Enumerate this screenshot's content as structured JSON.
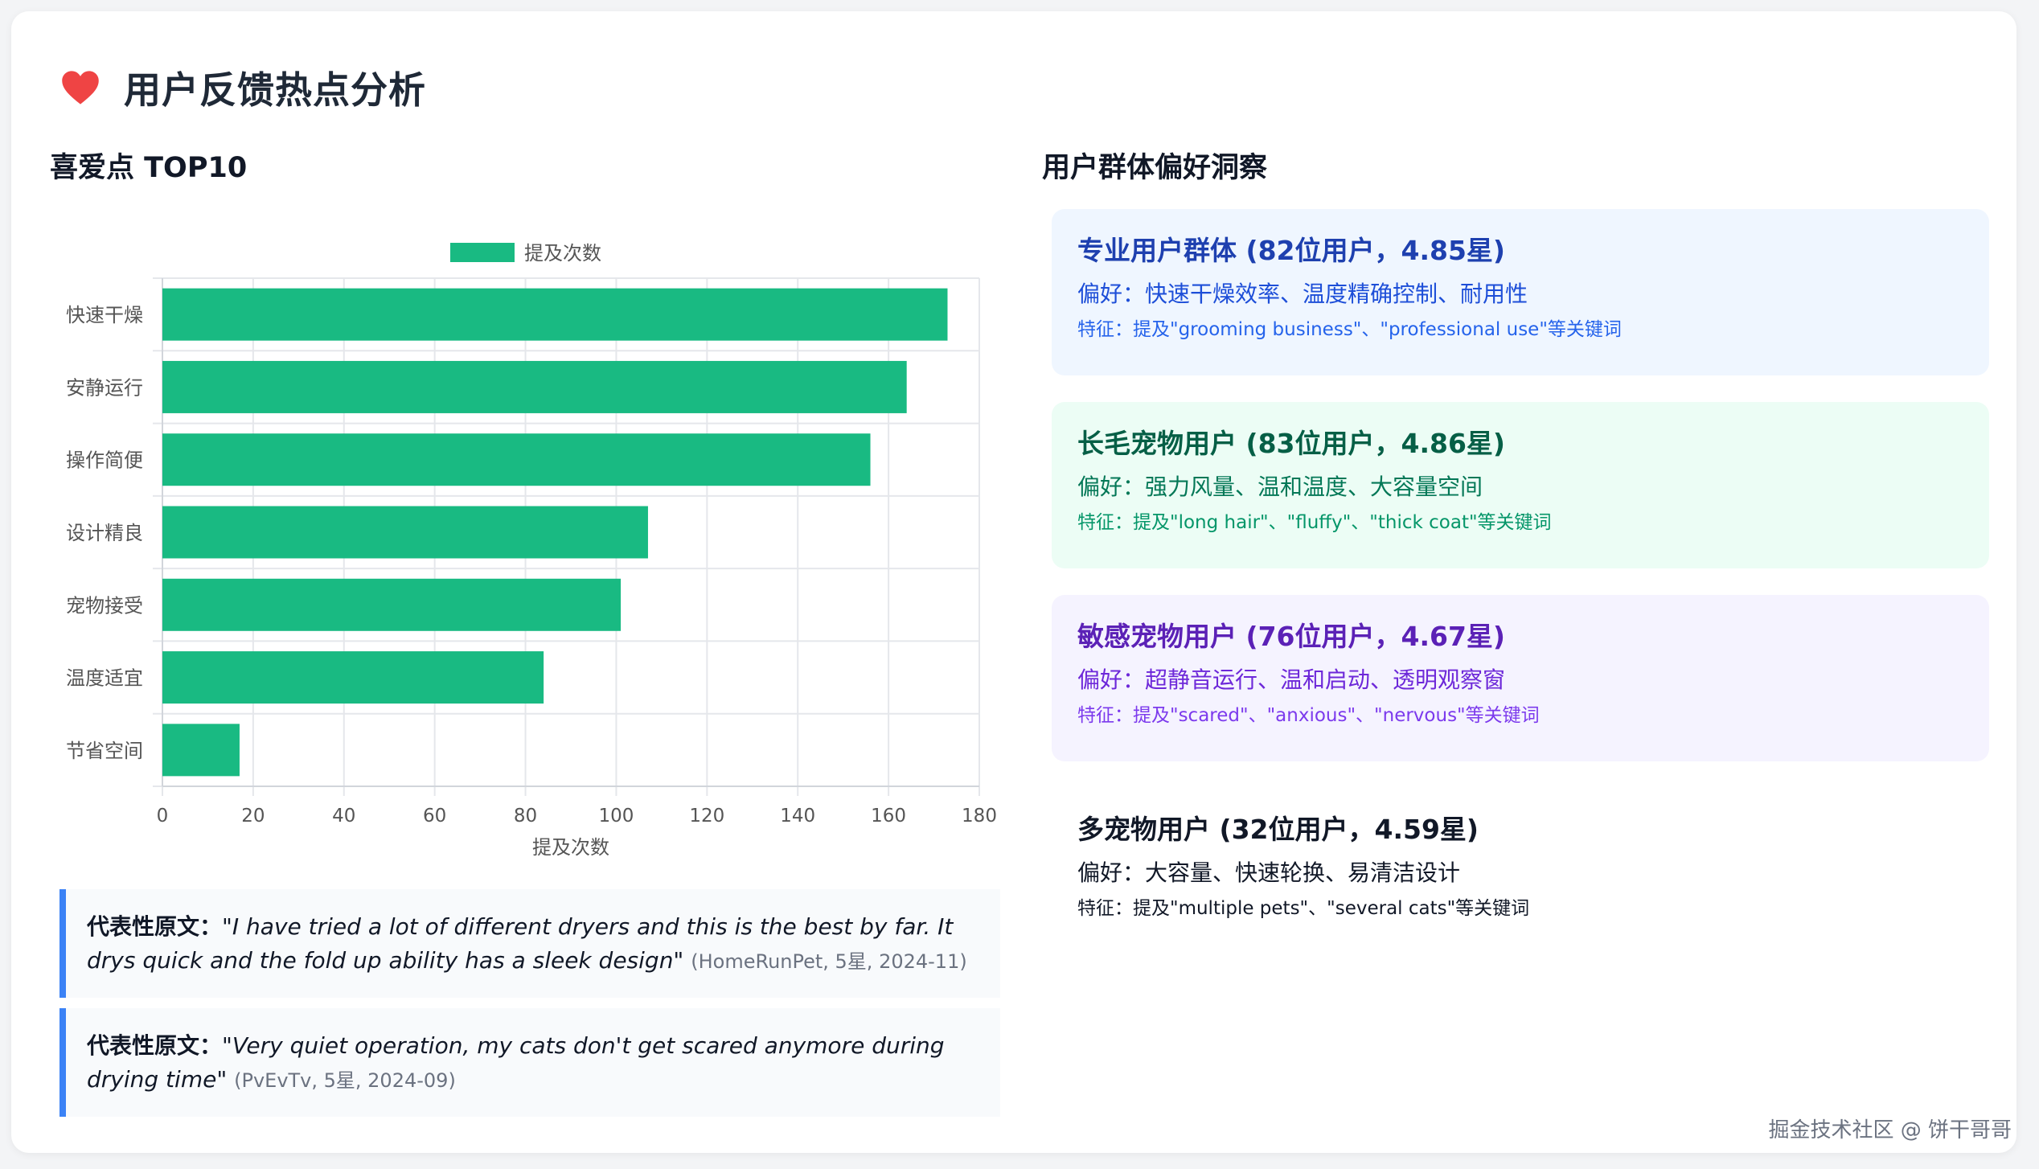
{
  "header": {
    "title": "用户反馈热点分析",
    "icon": "heart-icon",
    "icon_color": "#ef4444"
  },
  "left_section": {
    "title": "喜爱点 TOP10"
  },
  "chart_data": {
    "type": "bar",
    "orientation": "horizontal",
    "categories": [
      "快速干燥",
      "安静运行",
      "操作简便",
      "设计精良",
      "宠物接受",
      "温度适宜",
      "节省空间"
    ],
    "series": [
      {
        "name": "提及次数",
        "values": [
          173,
          164,
          156,
          107,
          101,
          84,
          17
        ],
        "color": "#19ba82"
      }
    ],
    "xlabel": "提及次数",
    "ylabel": "",
    "xlim": [
      0,
      180
    ],
    "xticks": [
      0,
      20,
      40,
      60,
      80,
      100,
      120,
      140,
      160,
      180
    ],
    "grid": true,
    "legend": "top-center"
  },
  "quotes": [
    {
      "label": "代表性原文：",
      "text": "\"I have tried a lot of different dryers and this is the best by far. It drys quick and the fold up ability has a sleek design\"",
      "source": "(HomeRunPet, 5星, 2024-11)"
    },
    {
      "label": "代表性原文：",
      "text": "\"Very quiet operation, my cats don't get scared anymore during drying time\"",
      "source": "(PvEvTv, 5星, 2024-09)"
    }
  ],
  "right_section": {
    "title": "用户群体偏好洞察"
  },
  "groups": [
    {
      "name": "专业用户群体 (82位用户，4.85星)",
      "preference": "偏好：快速干燥效率、温度精确控制、耐用性",
      "feature": "特征：提及\"grooming business\"、\"professional use\"等关键词",
      "bg": "#eff6ff",
      "name_color": "#1e40af",
      "pref_color": "#1d4ed8",
      "feat_color": "#2563eb"
    },
    {
      "name": "长毛宠物用户 (83位用户，4.86星)",
      "preference": "偏好：强力风量、温和温度、大容量空间",
      "feature": "特征：提及\"long hair\"、\"fluffy\"、\"thick coat\"等关键词",
      "bg": "#ecfdf5",
      "name_color": "#065f46",
      "pref_color": "#047857",
      "feat_color": "#059669"
    },
    {
      "name": "敏感宠物用户 (76位用户，4.67星)",
      "preference": "偏好：超静音运行、温和启动、透明观察窗",
      "feature": "特征：提及\"scared\"、\"anxious\"、\"nervous\"等关键词",
      "bg": "#f5f3ff",
      "name_color": "#5b21b6",
      "pref_color": "#6d28d9",
      "feat_color": "#7c3aed"
    },
    {
      "name": "多宠物用户 (32位用户，4.59星)",
      "preference": "偏好：大容量、快速轮换、易清洁设计",
      "feature": "特征：提及\"multiple pets\"、\"several cats\"等关键词",
      "bg": "#ffffff",
      "name_color": "#111827",
      "pref_color": "#111827",
      "feat_color": "#111827"
    }
  ],
  "footer": {
    "watermark": "掘金技术社区 @ 饼干哥哥"
  }
}
